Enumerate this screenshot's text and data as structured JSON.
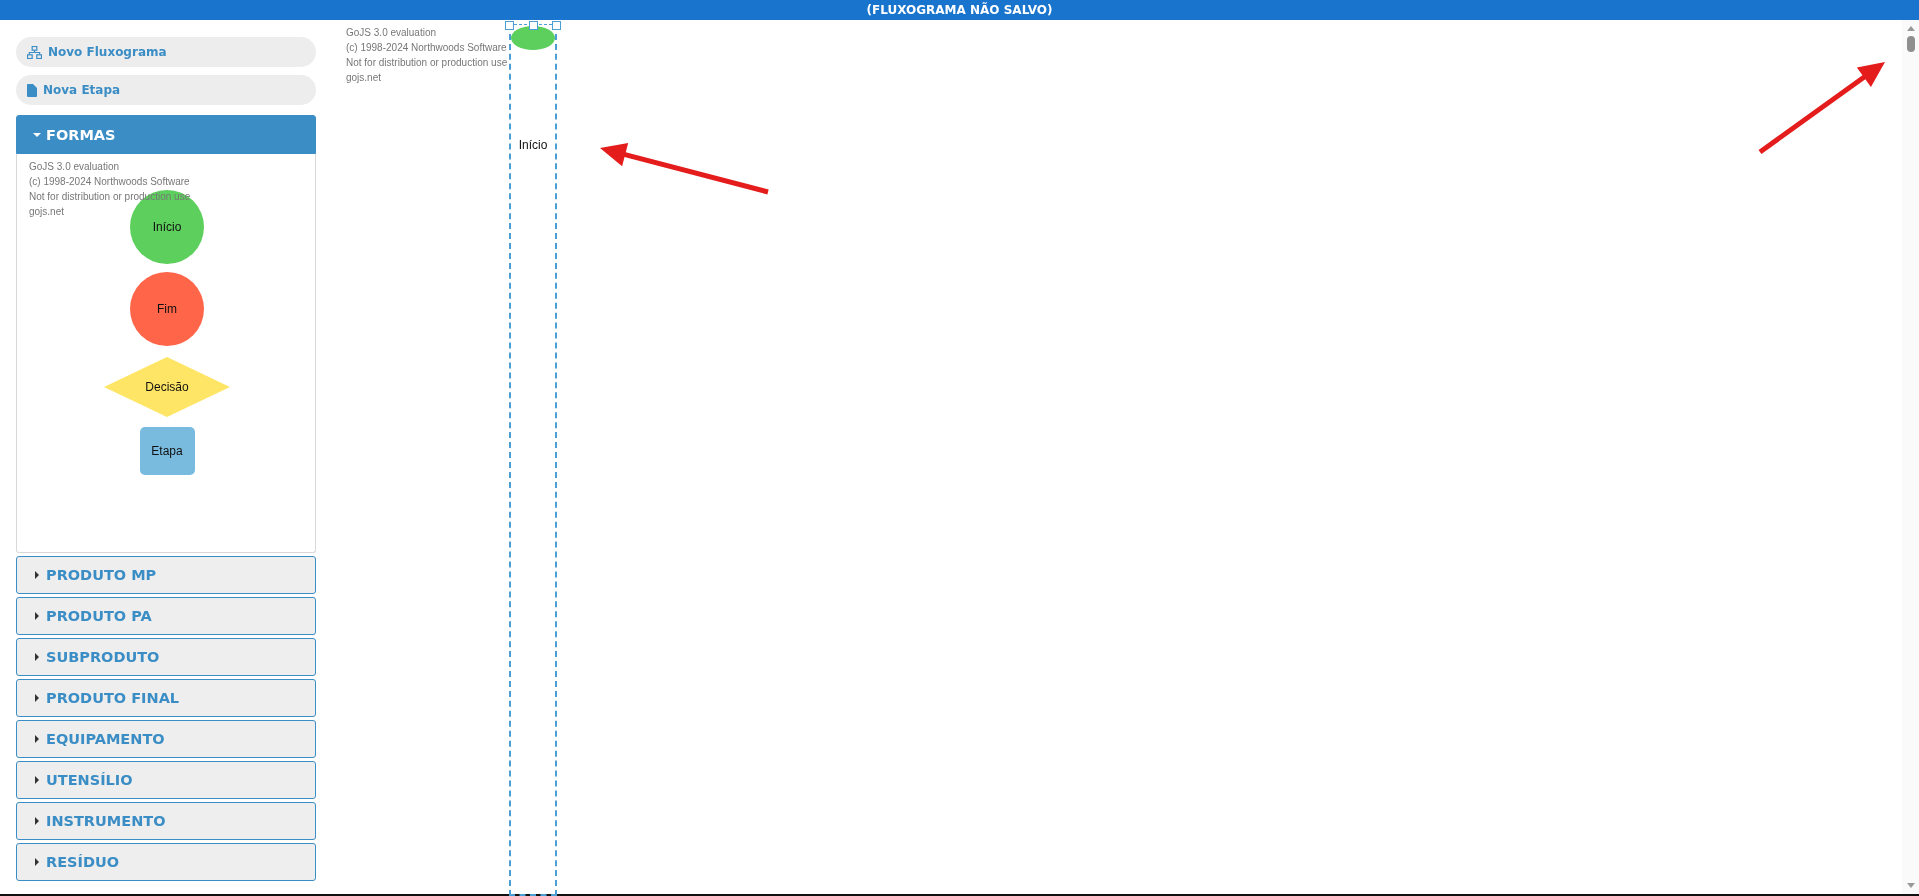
{
  "title_bar": {
    "title": "(FLUXOGRAMA NÃO SALVO)"
  },
  "sidebar": {
    "buttons": [
      {
        "label": "Novo Fluxograma"
      },
      {
        "label": "Nova Etapa"
      }
    ],
    "sections": [
      {
        "label": "FORMAS",
        "expanded": true
      },
      {
        "label": "PRODUTO MP",
        "expanded": false
      },
      {
        "label": "PRODUTO PA",
        "expanded": false
      },
      {
        "label": "SUBPRODUTO",
        "expanded": false
      },
      {
        "label": "PRODUTO FINAL",
        "expanded": false
      },
      {
        "label": "EQUIPAMENTO",
        "expanded": false
      },
      {
        "label": "UTENSÍLIO",
        "expanded": false
      },
      {
        "label": "INSTRUMENTO",
        "expanded": false
      },
      {
        "label": "RESÍDUO",
        "expanded": false
      }
    ]
  },
  "palette": {
    "watermark": [
      "GoJS 3.0 evaluation",
      "(c) 1998-2024 Northwoods Software",
      "Not for distribution or production use",
      "gojs.net"
    ],
    "shapes": [
      {
        "kind": "circle",
        "label": "Início",
        "color": "#5ccf5c"
      },
      {
        "kind": "circle",
        "label": "Fim",
        "color": "#ff6549"
      },
      {
        "kind": "diamond",
        "label": "Decisão",
        "color": "#ffe566"
      },
      {
        "kind": "rect",
        "label": "Etapa",
        "color": "#79bbdf"
      }
    ]
  },
  "canvas": {
    "watermark": [
      "GoJS 3.0 evaluation",
      "(c) 1998-2024 Northwoods Software",
      "Not for distribution or production use",
      "gojs.net"
    ],
    "nodes": [
      {
        "kind": "ellipse",
        "label": "Início",
        "color": "#5ccf5c",
        "selected": true
      }
    ]
  },
  "annotations": [
    {
      "kind": "arrow"
    },
    {
      "kind": "arrow"
    }
  ]
}
